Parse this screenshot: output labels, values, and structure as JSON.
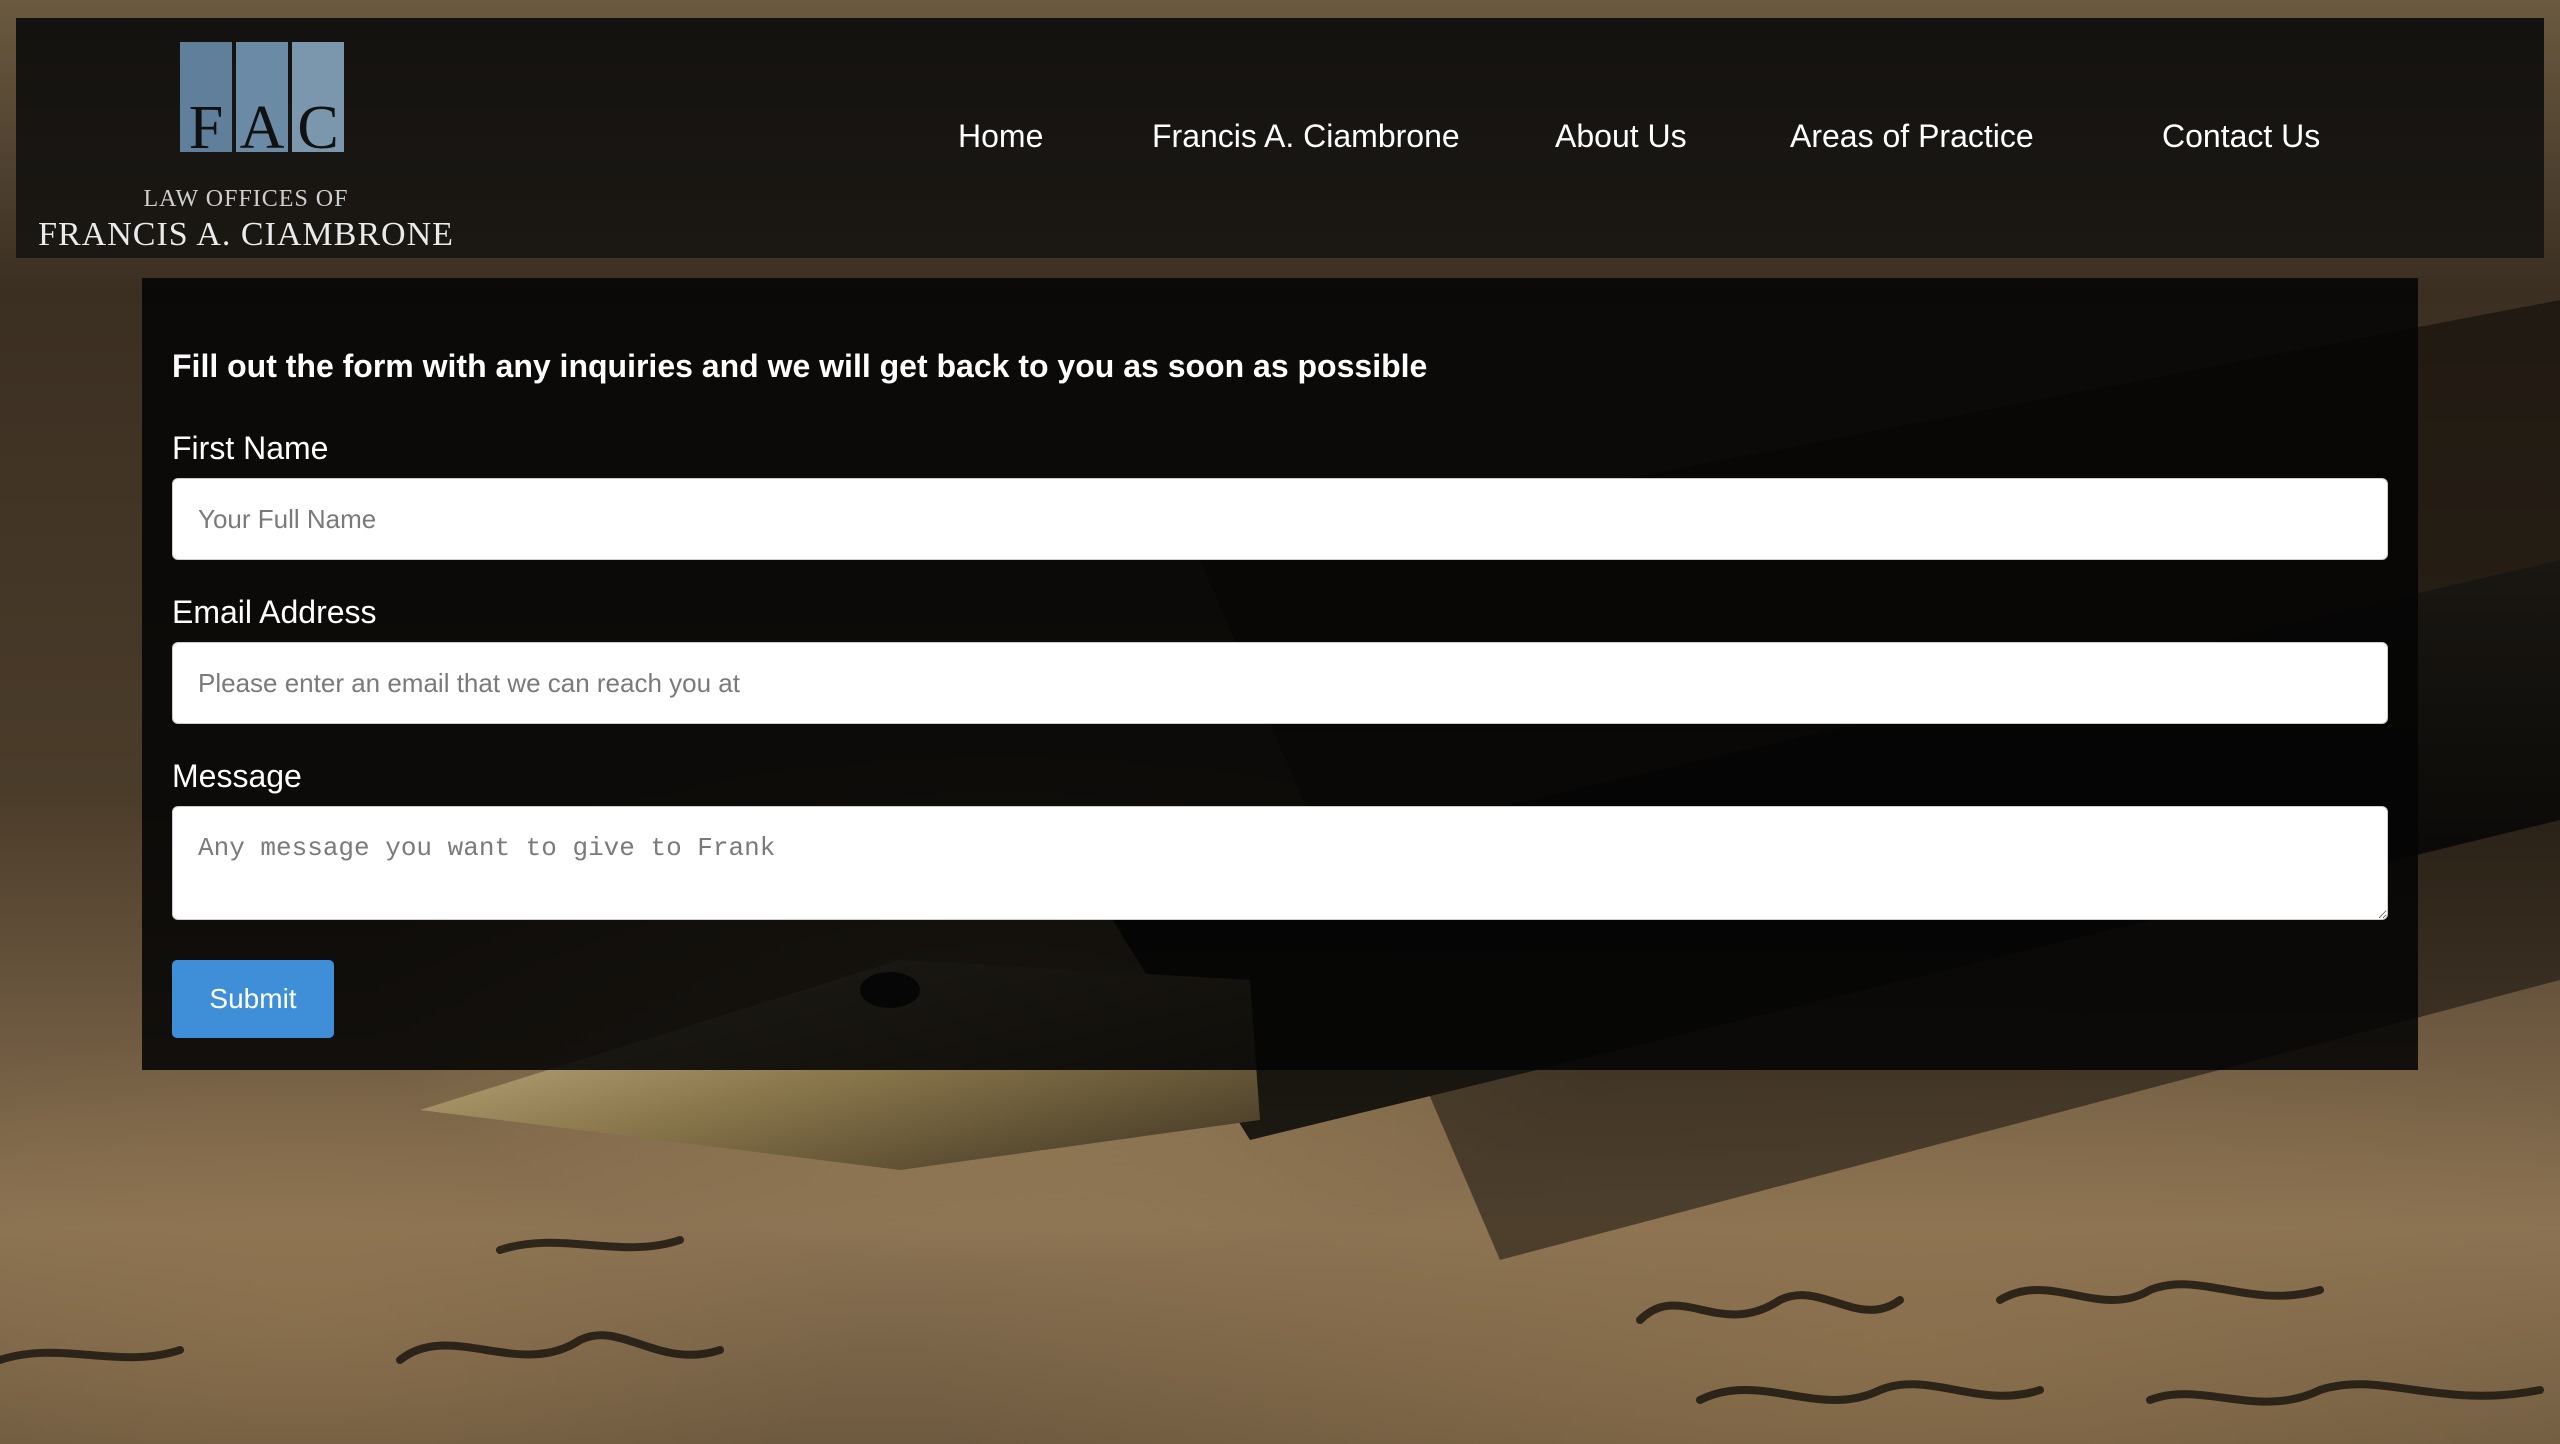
{
  "logo": {
    "letters": [
      "F",
      "A",
      "C"
    ],
    "line1": "LAW OFFICES OF",
    "line2": "FRANCIS A. CIAMBRONE"
  },
  "nav": {
    "items": [
      {
        "label": "Home"
      },
      {
        "label": "Francis A. Ciambrone"
      },
      {
        "label": "About Us"
      },
      {
        "label": "Areas of Practice"
      },
      {
        "label": "Contact Us"
      }
    ]
  },
  "form": {
    "heading": "Fill out the form with any inquiries and we will get back to you as soon as possible",
    "first_name": {
      "label": "First Name",
      "placeholder": "Your Full Name",
      "value": ""
    },
    "email": {
      "label": "Email Address",
      "placeholder": "Please enter an email that we can reach you at",
      "value": ""
    },
    "message": {
      "label": "Message",
      "placeholder": "Any message you want to give to Frank",
      "value": ""
    },
    "submit_label": "Submit"
  },
  "colors": {
    "submit_bg": "#3e8fd8",
    "header_bg": "#161410",
    "logo_blue": "#5f7f9a"
  }
}
